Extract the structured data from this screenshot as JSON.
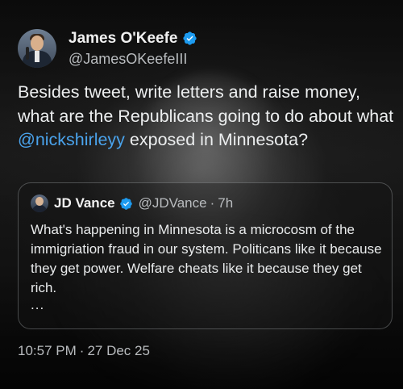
{
  "author": {
    "display_name": "James O'Keefe",
    "handle": "@JamesOKeefeIII",
    "verified_icon": "verified-badge-icon"
  },
  "tweet": {
    "text_before": "Besides tweet, write letters and raise money, what are the Republicans going to do about what ",
    "mention": "@nickshirleyy",
    "text_after": " exposed in Minnesota?"
  },
  "quote": {
    "display_name": "JD Vance",
    "handle": "@JDVance",
    "separator": "·",
    "time": "7h",
    "text": "What's happening in Minnesota is a microcosm of the immigriation fraud in our system. Politicans like it because they get power. Welfare cheats like it because they get rich.",
    "more": "..."
  },
  "timestamp": {
    "time": "10:57 PM",
    "separator": "·",
    "date": "27 Dec 25"
  },
  "colors": {
    "mention": "#4aa3ec",
    "verified": "#1d9bf0",
    "text": "#e7e9ea",
    "muted": "#b9bcbf"
  }
}
